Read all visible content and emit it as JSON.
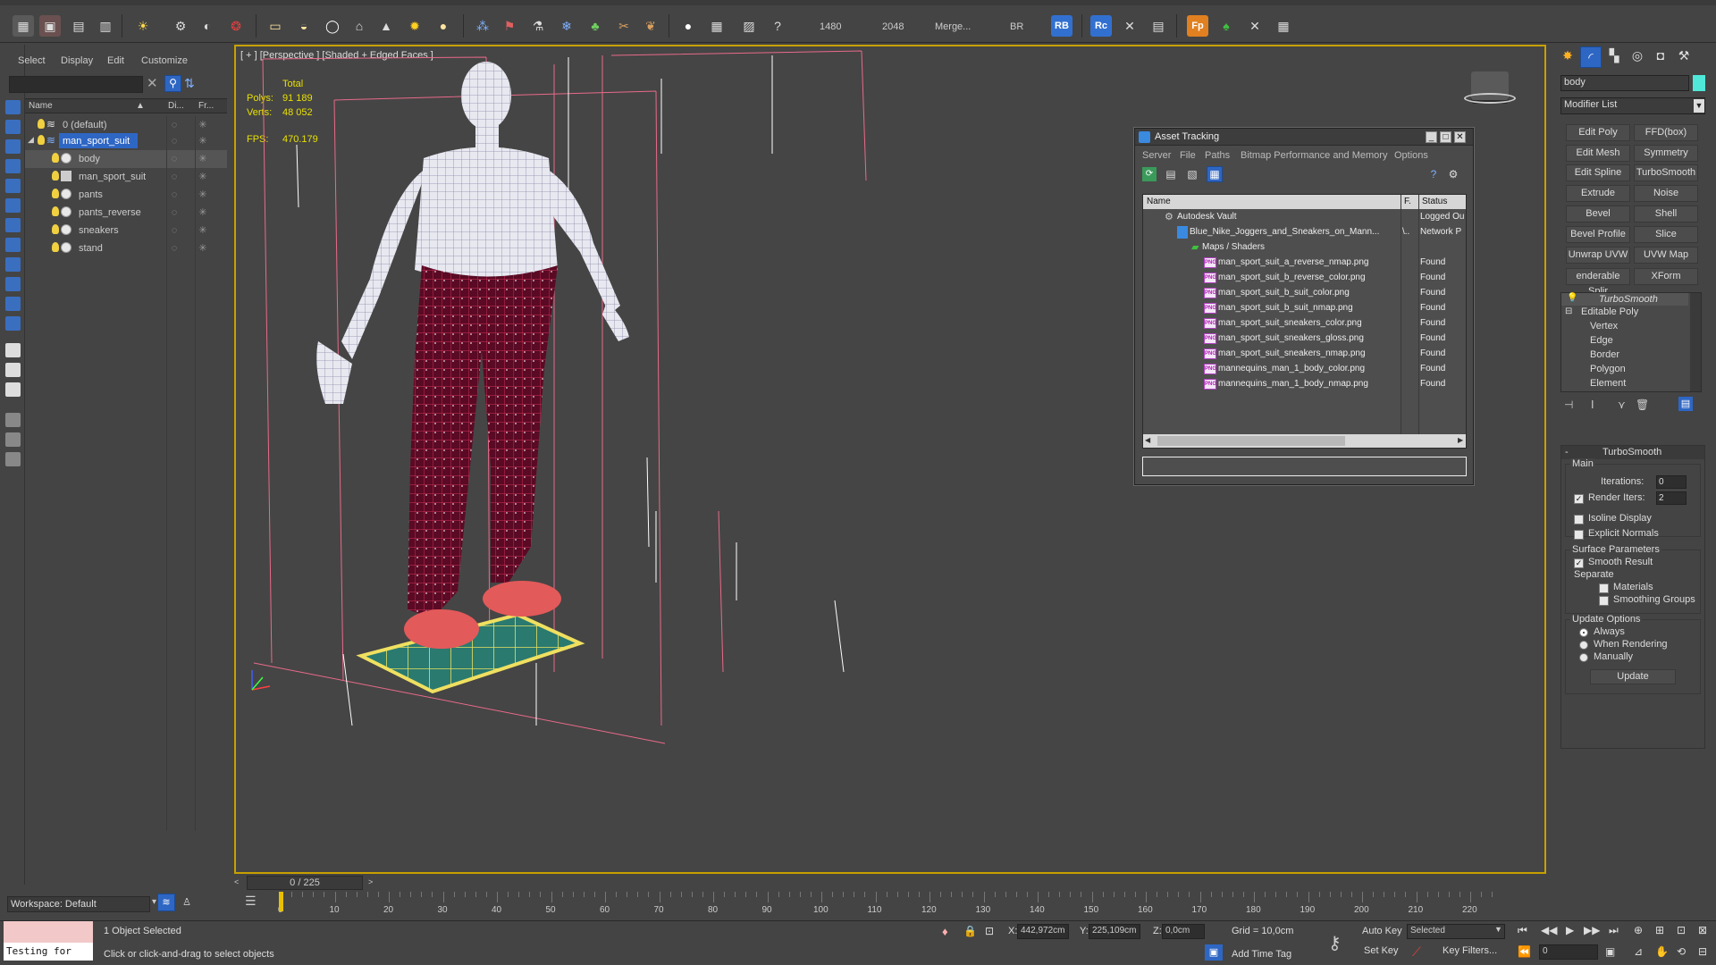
{
  "toolbar": {
    "render_width": "1480",
    "render_height": "2048",
    "merge_label": "Merge...",
    "br_label": "BR",
    "rb_label": "RB",
    "rc_label": "Rc",
    "fp_label": "Fp"
  },
  "explorer": {
    "menu": [
      "Select",
      "Display",
      "Edit",
      "Customize"
    ],
    "columns": {
      "name": "Name",
      "display": "Di...",
      "freeze": "Fr..."
    },
    "rows": [
      {
        "label": "0 (default)"
      },
      {
        "label": "man_sport_suit"
      },
      {
        "label": "body"
      },
      {
        "label": "man_sport_suit"
      },
      {
        "label": "pants"
      },
      {
        "label": "pants_reverse"
      },
      {
        "label": "sneakers"
      },
      {
        "label": "stand"
      }
    ],
    "workspace": "Workspace: Default"
  },
  "viewport": {
    "label": "[ + ] [Perspective ] [Shaded + Edged Faces ]",
    "stats": {
      "total_label": "Total",
      "polys_label": "Polys:",
      "polys_value": "91 189",
      "verts_label": "Verts:",
      "verts_value": "48 052",
      "fps_label": "FPS:",
      "fps_value": "470.179"
    }
  },
  "asset_tracking": {
    "title": "Asset Tracking",
    "menu": [
      "Server",
      "File",
      "Paths",
      "Bitmap Performance and Memory",
      "Options"
    ],
    "columns": {
      "name": "Name",
      "full_path": "F.",
      "status": "Status"
    },
    "rows": [
      {
        "name": "Autodesk Vault",
        "path": "",
        "status": "Logged Ou"
      },
      {
        "name": "Blue_Nike_Joggers_and_Sneakers_on_Mann...",
        "path": "\\..",
        "status": "Network P"
      },
      {
        "name": "Maps / Shaders",
        "path": "",
        "status": ""
      },
      {
        "name": "man_sport_suit_a_reverse_nmap.png",
        "path": "",
        "status": "Found"
      },
      {
        "name": "man_sport_suit_b_reverse_color.png",
        "path": "",
        "status": "Found"
      },
      {
        "name": "man_sport_suit_b_suit_color.png",
        "path": "",
        "status": "Found"
      },
      {
        "name": "man_sport_suit_b_suit_nmap.png",
        "path": "",
        "status": "Found"
      },
      {
        "name": "man_sport_suit_sneakers_color.png",
        "path": "",
        "status": "Found"
      },
      {
        "name": "man_sport_suit_sneakers_gloss.png",
        "path": "",
        "status": "Found"
      },
      {
        "name": "man_sport_suit_sneakers_nmap.png",
        "path": "",
        "status": "Found"
      },
      {
        "name": "mannequins_man_1_body_color.png",
        "path": "",
        "status": "Found"
      },
      {
        "name": "mannequins_man_1_body_nmap.png",
        "path": "",
        "status": "Found"
      }
    ]
  },
  "command_panel": {
    "object_name": "body",
    "modifier_list": "Modifier List",
    "buttons": [
      "Edit Poly",
      "FFD(box)",
      "Edit Mesh",
      "Symmetry",
      "Edit Spline",
      "TurboSmooth",
      "Extrude",
      "Noise",
      "Bevel",
      "Shell",
      "Bevel Profile",
      "Slice",
      "Unwrap UVW",
      "UVW Map",
      "enderable Splir",
      "XForm"
    ],
    "stack": [
      "TurboSmooth",
      "Editable Poly",
      "Vertex",
      "Edge",
      "Border",
      "Polygon",
      "Element"
    ],
    "turbosmooth": {
      "title": "TurboSmooth",
      "main": "Main",
      "iterations_label": "Iterations:",
      "iterations_value": "0",
      "render_iters_label": "Render Iters:",
      "render_iters_value": "2",
      "isoline": "Isoline Display",
      "explicit_normals": "Explicit Normals",
      "surface_params": "Surface Parameters",
      "smooth_result": "Smooth Result",
      "separate": "Separate",
      "materials": "Materials",
      "smoothing_groups": "Smoothing Groups",
      "update_options": "Update Options",
      "always": "Always",
      "when_rendering": "When Rendering",
      "manually": "Manually",
      "update_button": "Update"
    }
  },
  "timeline": {
    "frame_counter": "0 / 225",
    "ticks": [
      "0",
      "10",
      "20",
      "30",
      "40",
      "50",
      "60",
      "70",
      "80",
      "90",
      "100",
      "110",
      "120",
      "130",
      "140",
      "150",
      "160",
      "170",
      "180",
      "190",
      "200",
      "210",
      "220"
    ]
  },
  "status": {
    "script_text": "Testing for",
    "selection": "1 Object Selected",
    "prompt": "Click or click-and-drag to select objects",
    "x_label": "X:",
    "x_value": "442,972cm",
    "y_label": "Y:",
    "y_value": "225,109cm",
    "z_label": "Z:",
    "z_value": "0,0cm",
    "grid": "Grid = 10,0cm",
    "add_time_tag": "Add Time Tag",
    "auto_key": "Auto Key",
    "set_key": "Set Key",
    "selected": "Selected",
    "key_filters": "Key Filters...",
    "frame_value": "0"
  },
  "colors": {
    "accent_blue": "#2e66c4",
    "selection_yellow": "#c8a000",
    "stats_yellow": "#e8e000",
    "pants_red": "#8a1030",
    "sneaker_red": "#e35a5a",
    "stand_teal": "#2a7a70"
  }
}
